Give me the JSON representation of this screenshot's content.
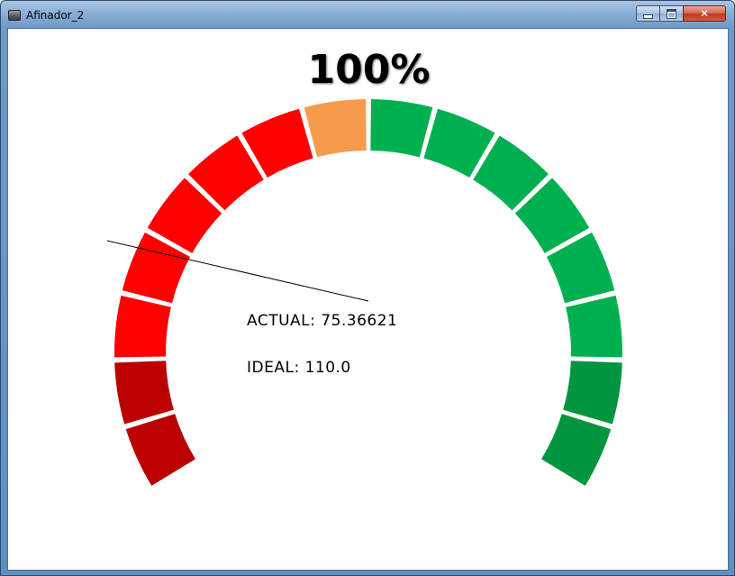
{
  "window": {
    "title": "Afinador_2"
  },
  "gauge": {
    "percent_label": "100%",
    "actual_label": "ACTUAL: 75.36621",
    "ideal_label": "IDEAL: 110.0",
    "segment_colors": [
      "#bb0000",
      "#bb0000",
      "#ff0000",
      "#ff0000",
      "#ff0000",
      "#ff0000",
      "#ff0000",
      "#f79b4d",
      "#00b050",
      "#00b050",
      "#00b050",
      "#00b050",
      "#00b050",
      "#00b050",
      "#00963f",
      "#00963f"
    ],
    "needle_color": "#000000"
  }
}
